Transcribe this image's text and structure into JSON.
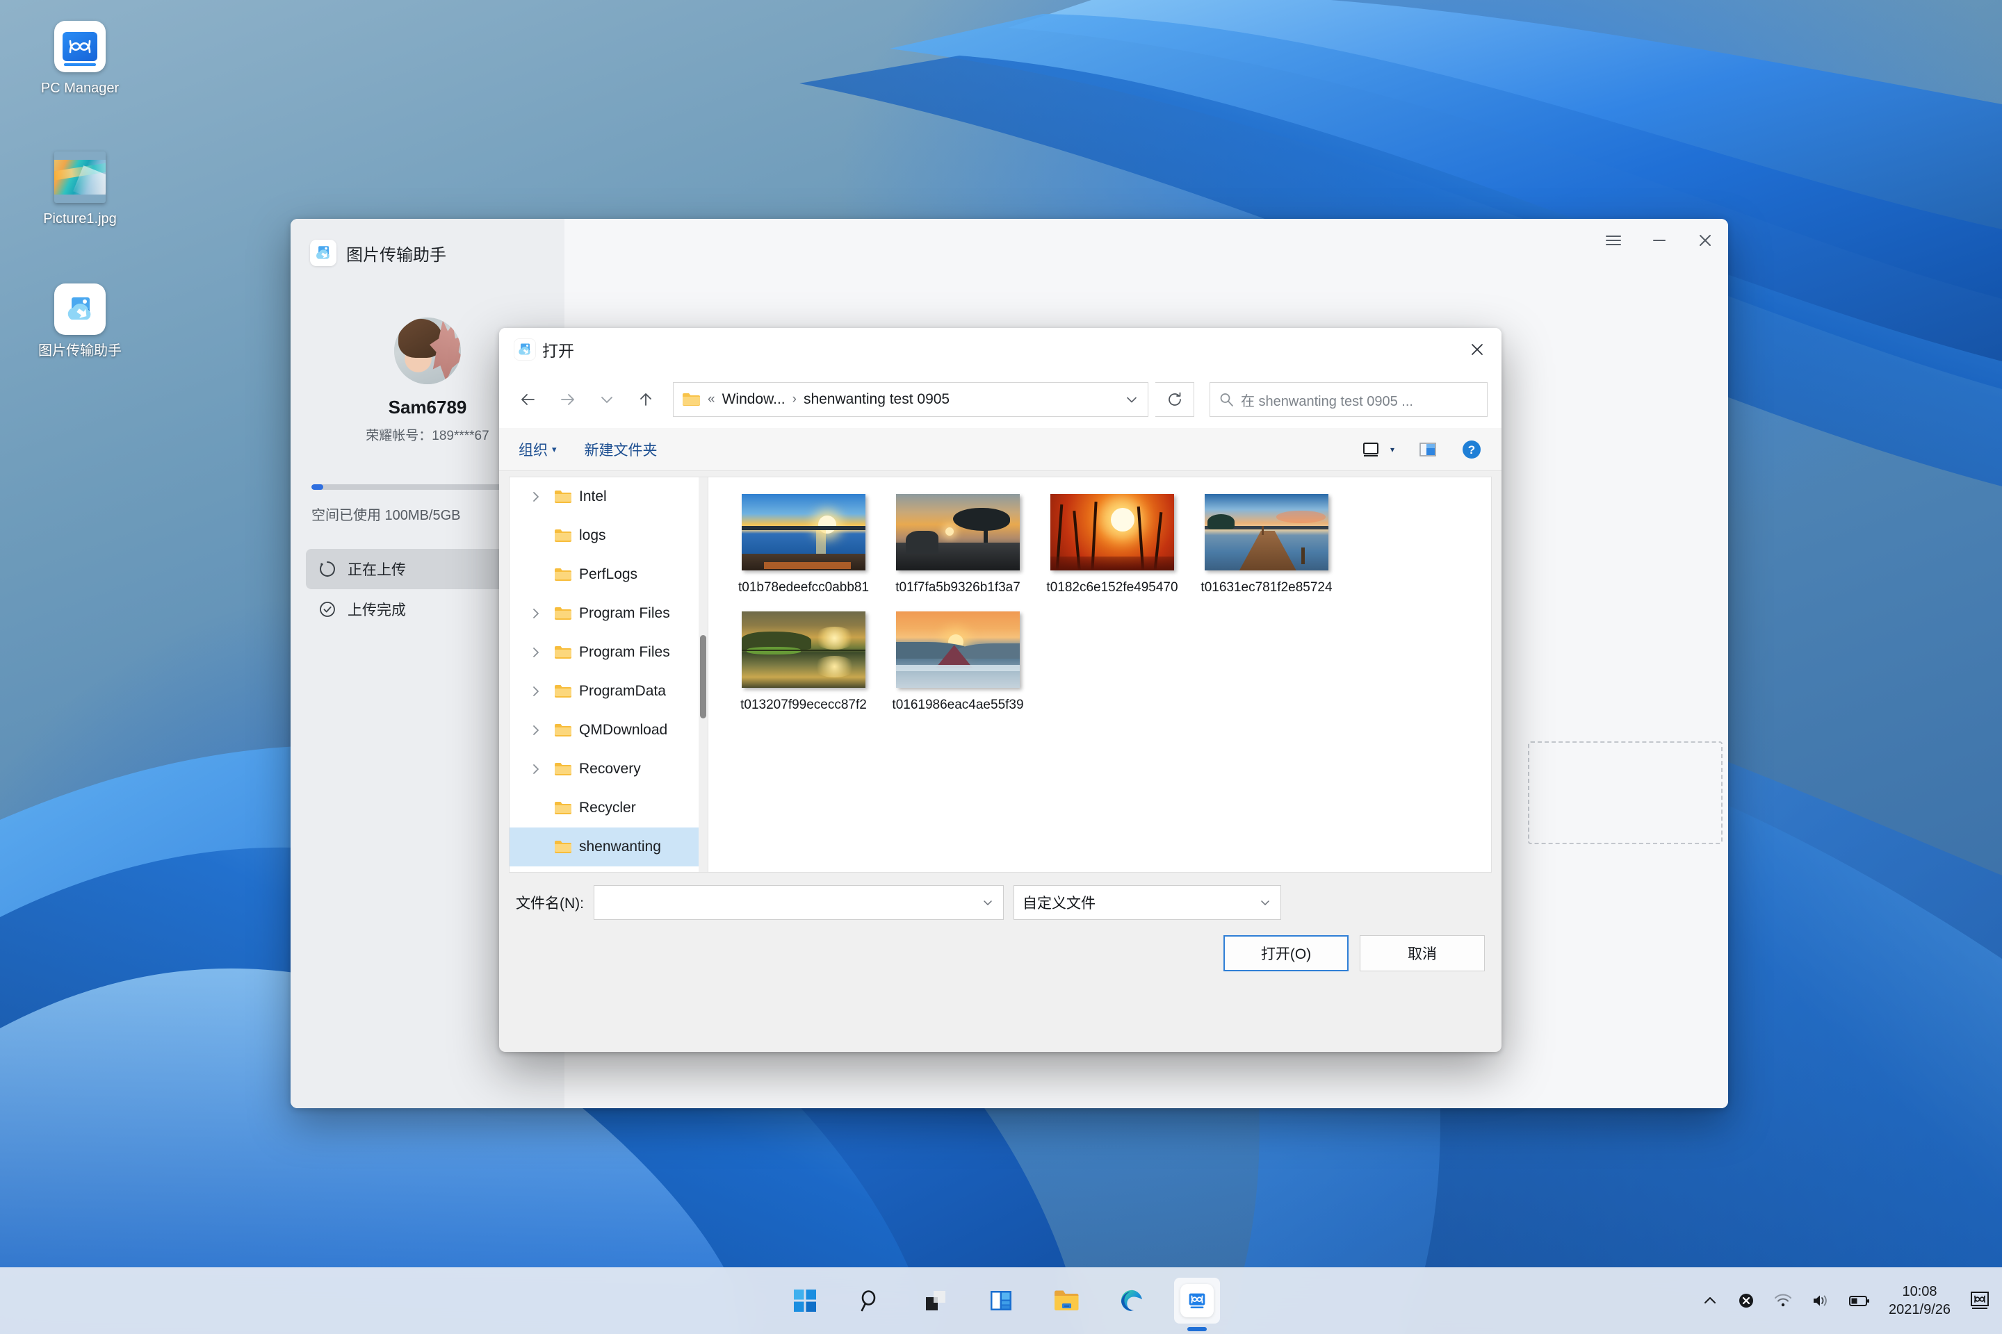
{
  "desktop": {
    "icons": [
      {
        "label": "PC Manager",
        "icon": "pc-manager-icon"
      },
      {
        "label": "Picture1.jpg",
        "icon": "image-file-icon"
      },
      {
        "label": "图片传输助手",
        "icon": "image-transfer-assistant-icon"
      }
    ]
  },
  "app_window": {
    "title": "图片传输助手",
    "title_icon": "image-transfer-assistant-icon",
    "window_controls": {
      "menu": "hamburger-menu-icon",
      "minimize": "minimize-icon",
      "close": "close-icon"
    },
    "account": {
      "avatar": "user-avatar",
      "name": "Sam6789",
      "account_line": "荣耀帐号：189****67"
    },
    "storage": {
      "text": "空间已使用 100MB/5GB",
      "percent": 2,
      "bar_color": "#2f6fe0"
    },
    "nav": [
      {
        "label": "正在上传",
        "icon": "uploading-spinner-icon",
        "active": true
      },
      {
        "label": "上传完成",
        "icon": "check-circle-icon",
        "active": false
      }
    ]
  },
  "dialog": {
    "title": "打开",
    "title_icon": "image-transfer-assistant-icon",
    "close_icon": "close-icon",
    "nav": {
      "back_icon": "arrow-left-icon",
      "forward_icon": "arrow-right-icon",
      "recent_icon": "chevron-down-icon",
      "up_icon": "arrow-up-icon"
    },
    "address": {
      "folder_icon": "folder-icon",
      "overflow": "«",
      "crumbs": [
        "Window...",
        "shenwanting test 0905"
      ],
      "separator": "›",
      "chevron": "chevron-down-icon",
      "refresh_icon": "refresh-icon"
    },
    "search": {
      "icon": "search-icon",
      "placeholder": "在 shenwanting test 0905 ..."
    },
    "toolbar": {
      "organize_label": "组织",
      "organize_caret": "▾",
      "new_folder_label": "新建文件夹",
      "view_icon": "view-layout-icon",
      "view_caret": "▾",
      "preview_icon": "preview-pane-icon",
      "help_icon": "help-icon"
    },
    "tree": [
      {
        "label": "Intel",
        "expandable": true,
        "selected": false
      },
      {
        "label": "logs",
        "expandable": false,
        "selected": false
      },
      {
        "label": "PerfLogs",
        "expandable": false,
        "selected": false
      },
      {
        "label": "Program Files",
        "expandable": true,
        "selected": false
      },
      {
        "label": "Program Files",
        "expandable": true,
        "selected": false
      },
      {
        "label": "ProgramData",
        "expandable": true,
        "selected": false
      },
      {
        "label": "QMDownload",
        "expandable": true,
        "selected": false
      },
      {
        "label": "Recovery",
        "expandable": true,
        "selected": false
      },
      {
        "label": "Recycler",
        "expandable": false,
        "selected": false
      },
      {
        "label": "shenwanting",
        "expandable": false,
        "selected": true
      }
    ],
    "files": [
      {
        "name": "t01b78edeefcc0abb81",
        "thumb": "sunset-lake-thumb"
      },
      {
        "name": "t01f7fa5b9326b1f3a7",
        "thumb": "sunset-tree-cliff-thumb"
      },
      {
        "name": "t0182c6e152fe495470",
        "thumb": "sunset-reeds-thumb"
      },
      {
        "name": "t01631ec781f2e85724",
        "thumb": "sunset-pier-thumb"
      },
      {
        "name": "t013207f99ececc87f2",
        "thumb": "sunset-reflection-thumb"
      },
      {
        "name": "t0161986eac4ae55f39",
        "thumb": "sunrise-mountain-thumb"
      }
    ],
    "footer": {
      "filename_label": "文件名(N):",
      "filename_value": "",
      "filename_chevron": "chevron-down-icon",
      "filetype_value": "自定义文件",
      "filetype_chevron": "chevron-down-icon",
      "open_button": "打开(O)",
      "cancel_button": "取消",
      "accent_color": "#2f7fd6"
    }
  },
  "taskbar": {
    "buttons": [
      {
        "name": "start-button",
        "icon": "windows-logo-icon",
        "active": false
      },
      {
        "name": "search-button",
        "icon": "search-icon",
        "active": false
      },
      {
        "name": "task-view-button",
        "icon": "task-view-icon",
        "active": false
      },
      {
        "name": "widgets-button",
        "icon": "widgets-icon",
        "active": false
      },
      {
        "name": "file-explorer-button",
        "icon": "folder-icon",
        "active": false
      },
      {
        "name": "edge-button",
        "icon": "edge-icon",
        "active": false
      },
      {
        "name": "pc-manager-button",
        "icon": "pc-manager-icon",
        "active": true
      }
    ],
    "tray": {
      "overflow_icon": "chevron-up-icon",
      "security_icon": "close-circle-icon",
      "wifi_icon": "wifi-icon",
      "volume_icon": "volume-icon",
      "battery_icon": "battery-icon",
      "time": "10:08",
      "date": "2021/9/26",
      "notification_icon": "pc-manager-tray-icon"
    }
  }
}
